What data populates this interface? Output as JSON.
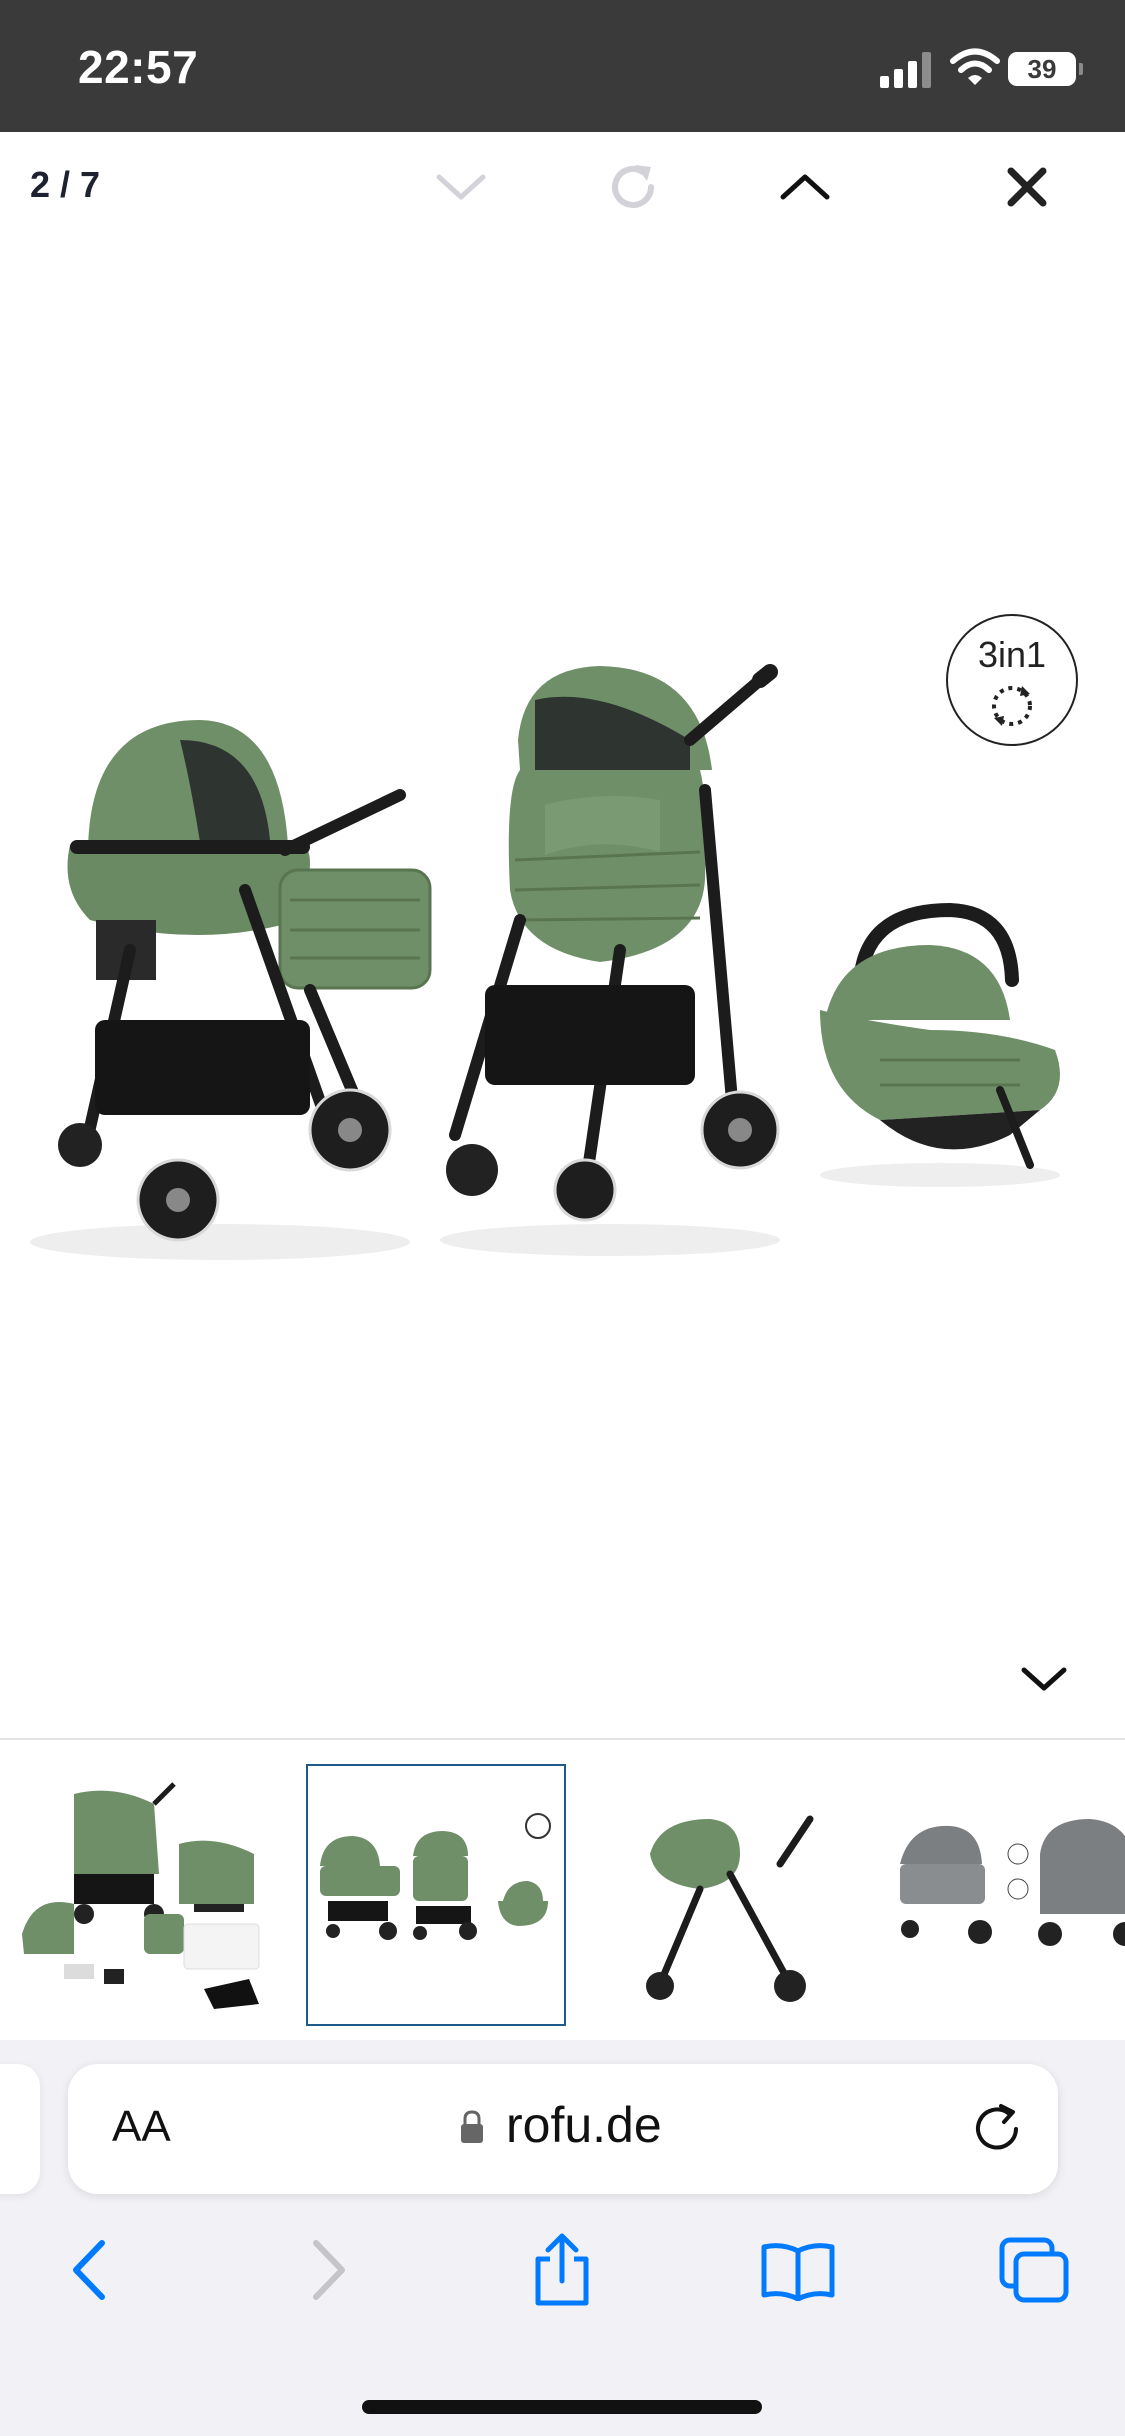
{
  "status_bar": {
    "time": "22:57",
    "battery": "39"
  },
  "viewer": {
    "counter": "2 / 7",
    "badge_text": "3in1"
  },
  "thumbnails": [
    {
      "label": "Stroller set with accessories"
    },
    {
      "label": "3in1 stroller, seat unit and car seat",
      "active": true
    },
    {
      "label": "Stroller with car seat"
    },
    {
      "label": "Grey stroller variant"
    }
  ],
  "browser": {
    "text_size_label": "AA",
    "url": "rofu.de"
  },
  "colors": {
    "accent": "#007aff",
    "stroller_green": "#6f8f68",
    "frame": "#1c1c1c"
  },
  "icons": {
    "toolbar": [
      "chevron-down-icon",
      "rotate-icon",
      "chevron-up-icon",
      "close-icon"
    ],
    "nav": [
      "back-icon",
      "forward-icon",
      "share-icon",
      "bookmarks-icon",
      "tabs-icon"
    ]
  }
}
